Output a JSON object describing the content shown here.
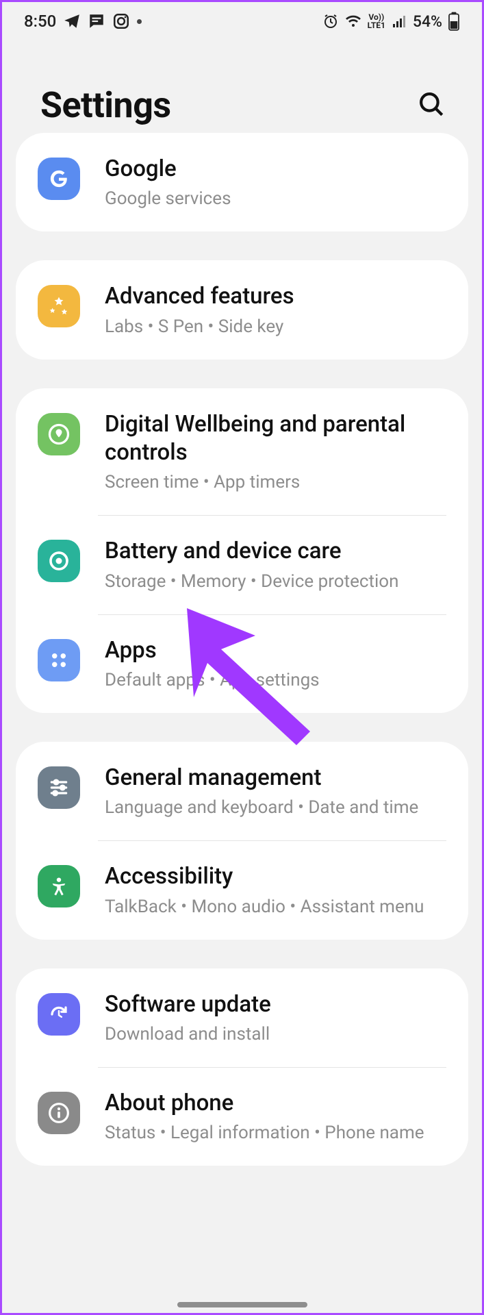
{
  "status_bar": {
    "time": "8:50",
    "battery_percent": "54%"
  },
  "header": {
    "title": "Settings"
  },
  "groups": [
    {
      "id": "g0",
      "clip_top": true,
      "items": [
        {
          "id": "google",
          "icon": "google",
          "title": "Google",
          "subtitle": "Google services"
        }
      ]
    },
    {
      "id": "g1",
      "items": [
        {
          "id": "advanced",
          "icon": "adv",
          "title": "Advanced features",
          "subtitle": "Labs  •  S Pen  •  Side key"
        }
      ]
    },
    {
      "id": "g2",
      "items": [
        {
          "id": "wellbeing",
          "icon": "dwb",
          "title": "Digital Wellbeing and parental controls",
          "subtitle": "Screen time  •  App timers"
        },
        {
          "id": "battery",
          "icon": "batt",
          "title": "Battery and device care",
          "subtitle": "Storage  •  Memory  •  Device protection"
        },
        {
          "id": "apps",
          "icon": "apps",
          "title": "Apps",
          "subtitle": "Default apps  •  App settings"
        }
      ]
    },
    {
      "id": "g3",
      "items": [
        {
          "id": "general",
          "icon": "gen",
          "title": "General management",
          "subtitle": "Language and keyboard  •  Date and time"
        },
        {
          "id": "accessibility",
          "icon": "acc",
          "title": "Accessibility",
          "subtitle": "TalkBack  •  Mono audio  •  Assistant menu"
        }
      ]
    },
    {
      "id": "g4",
      "items": [
        {
          "id": "software",
          "icon": "sw",
          "title": "Software update",
          "subtitle": "Download and install"
        },
        {
          "id": "about",
          "icon": "about",
          "title": "About phone",
          "subtitle": "Status  •  Legal information  •  Phone name"
        }
      ]
    }
  ]
}
